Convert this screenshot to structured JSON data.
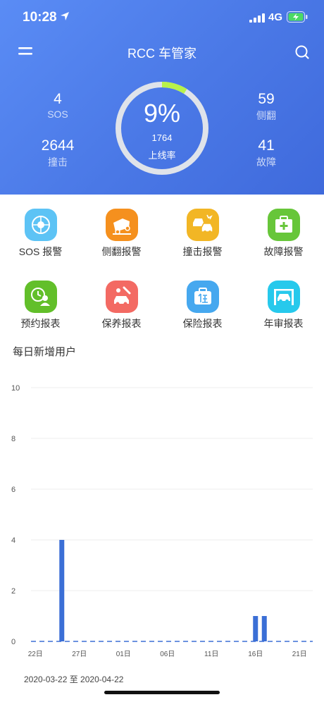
{
  "status_bar": {
    "time": "10:28",
    "network": "4G"
  },
  "header": {
    "title": "RCC 车管家",
    "stats": {
      "sos": {
        "value": "4",
        "label": "SOS"
      },
      "collision": {
        "value": "2644",
        "label": "撞击"
      },
      "rollover": {
        "value": "59",
        "label": "侧翻"
      },
      "fault": {
        "value": "41",
        "label": "故障"
      }
    },
    "gauge": {
      "percent_text": "9%",
      "percent": 0.09,
      "count": "1764",
      "label": "上线率",
      "track_color": "#dfe3ea",
      "fill_color": "#b8f24a"
    }
  },
  "actions": [
    {
      "label": "SOS 报警",
      "icon": "sos-icon",
      "color": "#5dc3f5"
    },
    {
      "label": "侧翻报警",
      "icon": "rollover-car-icon",
      "color": "#f5901e"
    },
    {
      "label": "撞击报警",
      "icon": "collision-cars-icon",
      "color": "#f2b625"
    },
    {
      "label": "故障报警",
      "icon": "toolbox-icon",
      "color": "#67c63a"
    },
    {
      "label": "预约报表",
      "icon": "clock-user-icon",
      "color": "#62bf2a"
    },
    {
      "label": "保养报表",
      "icon": "car-repair-icon",
      "color": "#f36a63"
    },
    {
      "label": "保险报表",
      "icon": "insurance-bag-icon",
      "color": "#46a8ef"
    },
    {
      "label": "年审报表",
      "icon": "car-lift-icon",
      "color": "#27c9ec"
    }
  ],
  "section": {
    "title": "每日新增用户"
  },
  "chart_data": {
    "type": "bar",
    "title": "每日新增用户",
    "ylim": [
      0,
      10
    ],
    "y_ticks": [
      "0",
      "2",
      "4",
      "6",
      "8",
      "10"
    ],
    "x_tick_labels": [
      "22日",
      "27日",
      "01日",
      "06日",
      "11日",
      "16日",
      "21日"
    ],
    "categories": [
      "03-22",
      "03-23",
      "03-24",
      "03-25",
      "03-26",
      "03-27",
      "03-28",
      "03-29",
      "03-30",
      "03-31",
      "04-01",
      "04-02",
      "04-03",
      "04-04",
      "04-05",
      "04-06",
      "04-07",
      "04-08",
      "04-09",
      "04-10",
      "04-11",
      "04-12",
      "04-13",
      "04-14",
      "04-15",
      "04-16",
      "04-17",
      "04-18",
      "04-19",
      "04-20",
      "04-21",
      "04-22"
    ],
    "values": [
      0,
      0,
      0,
      4,
      0,
      0,
      0,
      0,
      0,
      0,
      0,
      0,
      0,
      0,
      0,
      0,
      0,
      0,
      0,
      0,
      0,
      0,
      0,
      0,
      0,
      1,
      1,
      0,
      0,
      0,
      0,
      0
    ],
    "bar_color": "#3b6fd6",
    "grid": true
  },
  "footer": {
    "range": "2020-03-22 至 2020-04-22"
  }
}
